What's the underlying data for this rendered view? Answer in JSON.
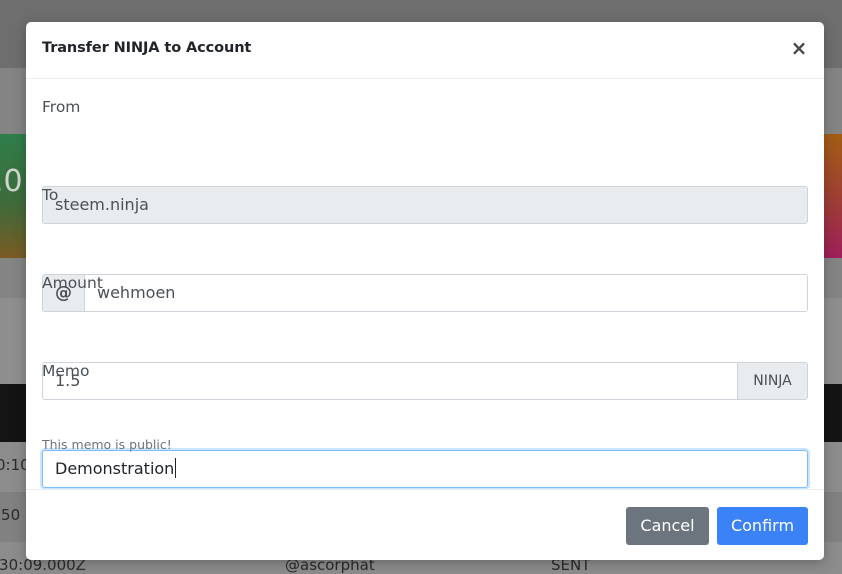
{
  "background": {
    "card_left_value": ".0",
    "rows": [
      {
        "time": "0:10:"
      },
      {
        "time": ":50"
      },
      {
        "time": ":30:09.000Z",
        "account": "@ascorphat",
        "status": "SENT"
      }
    ]
  },
  "modal": {
    "title": "Transfer NINJA to Account",
    "close_glyph": "×",
    "from": {
      "label": "From",
      "value": "steem.ninja"
    },
    "to": {
      "label": "To",
      "prefix": "@",
      "value": "wehmoen"
    },
    "amount": {
      "label": "Amount",
      "value": "1.5",
      "unit": "NINJA"
    },
    "memo": {
      "label": "Memo",
      "value": "Demonstration",
      "help": "This memo is public!"
    },
    "buttons": {
      "cancel": "Cancel",
      "confirm": "Confirm"
    }
  },
  "colors": {
    "primary": "#3b82f6",
    "secondary": "#6c757d",
    "readonly_bg": "#e9ecef",
    "focus_border": "#80bdff"
  }
}
